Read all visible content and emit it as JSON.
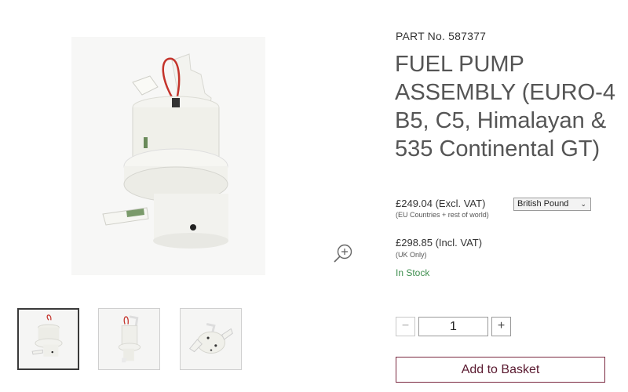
{
  "product": {
    "part_no": "PART No. 587377",
    "title": "FUEL PUMP ASSEMBLY (EURO-4 B5, C5, Himalayan & 535 Continental GT)"
  },
  "pricing": {
    "excl_vat": "£249.04 (Excl. VAT)",
    "excl_vat_note": "(EU Countries + rest of world)",
    "incl_vat": "£298.85 (Incl. VAT)",
    "incl_vat_note": "(UK Only)",
    "currency_selected": "British Pound",
    "stock_status": "In Stock",
    "stock_color": "#3f8f4f"
  },
  "quantity": {
    "value": "1",
    "minus_label": "−",
    "plus_label": "+"
  },
  "actions": {
    "add_to_basket": "Add to Basket",
    "accent": "#7a2840"
  },
  "gallery": {
    "thumbnail_count": 3,
    "selected_index": 0,
    "zoom_icon": "zoom-in-icon"
  }
}
